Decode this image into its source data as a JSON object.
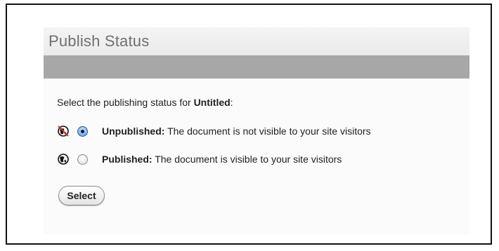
{
  "panel": {
    "title": "Publish Status"
  },
  "prompt": {
    "text_before": "Select the publishing status for ",
    "document_name": "Untitled",
    "text_after": ":"
  },
  "options": [
    {
      "label": "Unpublished:",
      "description": " The document is not visible to your site visitors",
      "selected": true,
      "icon": "unpublished-globe-icon"
    },
    {
      "label": "Published:",
      "description": " The document is visible to your site visitors",
      "selected": false,
      "icon": "published-globe-icon"
    }
  ],
  "actions": {
    "select_label": "Select"
  },
  "colors": {
    "title_text": "#707070",
    "header_strip": "#a7a7a7",
    "radio_selected": "#5a93d6"
  }
}
